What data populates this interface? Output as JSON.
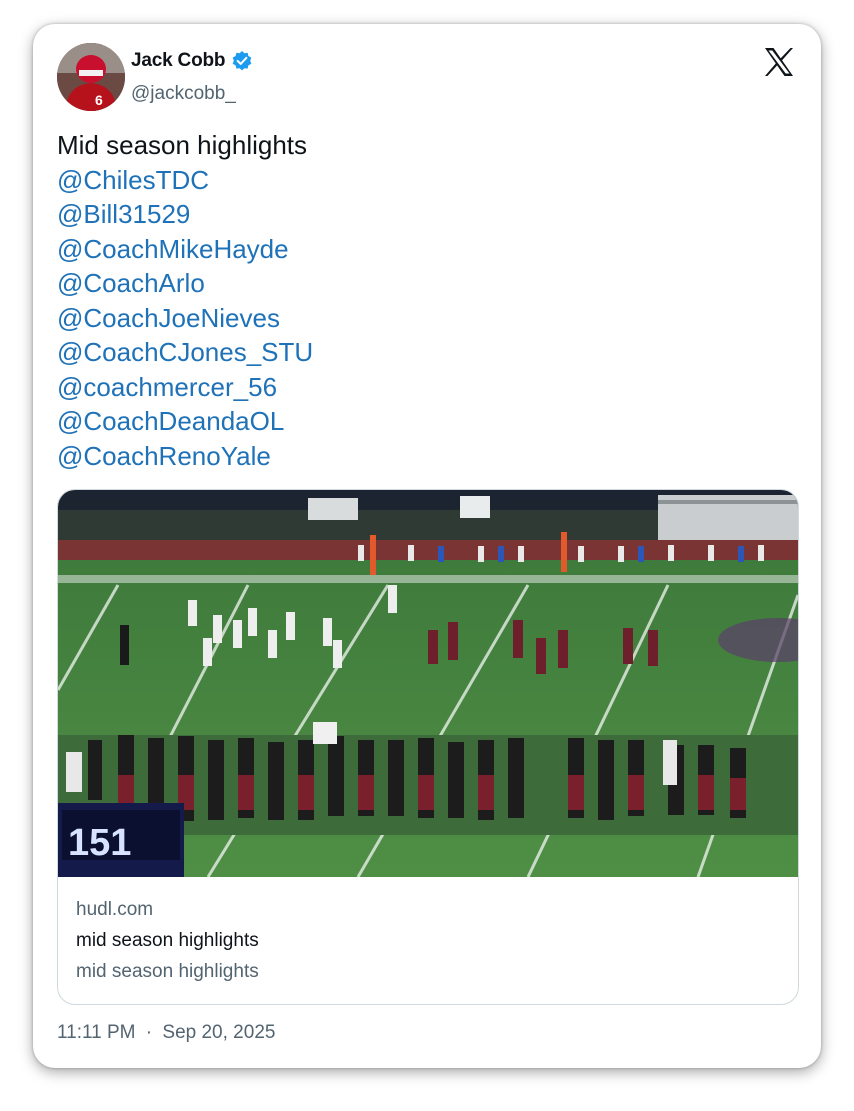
{
  "author": {
    "name": "Jack Cobb",
    "handle": "@jackcobb_",
    "verified": true,
    "verified_color": "#1d9bf0"
  },
  "brand": {
    "icon": "x-logo-icon"
  },
  "tweet": {
    "text": "Mid season highlights",
    "mentions": [
      "@ChilesTDC",
      "@Bill31529",
      "@CoachMikeHayde",
      "@CoachArlo",
      "@CoachJoeNieves",
      "@CoachCJones_STU",
      "@coachmercer_56",
      "@CoachDeandaOL",
      "@CoachRenoYale"
    ],
    "mention_color": "#1f72b8"
  },
  "link_card": {
    "media_icon": "football-highlight-video-thumbnail",
    "scoreboard_text": "151",
    "domain": "hudl.com",
    "title": "mid season highlights",
    "description": "mid season highlights"
  },
  "timestamp": {
    "time": "11:11 PM",
    "separator": "·",
    "date": "Sep 20, 2025"
  }
}
